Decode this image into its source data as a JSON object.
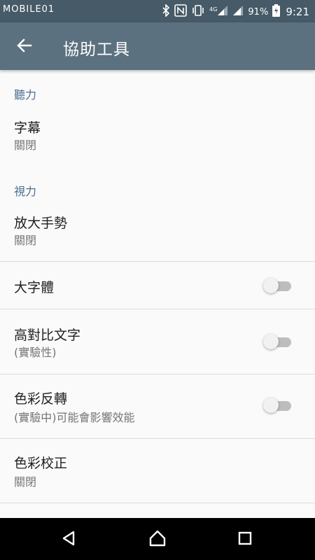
{
  "status_bar": {
    "watermark": "MOBILE01",
    "network": "4G",
    "battery_percent": "91%",
    "time": "9:21",
    "icons": [
      "bluetooth-icon",
      "nfc-icon",
      "vibrate-icon",
      "signal-icon",
      "battery-charging-icon"
    ]
  },
  "app_bar": {
    "back_icon": "arrow-back-icon",
    "title": "協助工具"
  },
  "sections": {
    "hearing": {
      "header": "聽力",
      "captions": {
        "title": "字幕",
        "subtitle": "關閉"
      }
    },
    "vision": {
      "header": "視力",
      "magnification": {
        "title": "放大手勢",
        "subtitle": "關閉"
      },
      "large_text": {
        "title": "大字體",
        "enabled": false
      },
      "high_contrast": {
        "title": "高對比文字",
        "subtitle": "(實驗性)",
        "enabled": false
      },
      "color_inversion": {
        "title": "色彩反轉",
        "subtitle": "(實驗中)可能會影響效能",
        "enabled": false
      },
      "color_correction": {
        "title": "色彩校正",
        "subtitle": "關閉"
      }
    }
  },
  "nav_bar": {
    "icons": [
      "back-triangle-icon",
      "home-icon",
      "recents-icon"
    ]
  },
  "colors": {
    "status_bar": "#465a67",
    "app_bar": "#5b7180",
    "section_header": "#4c6f8f",
    "background": "#fafafa"
  }
}
